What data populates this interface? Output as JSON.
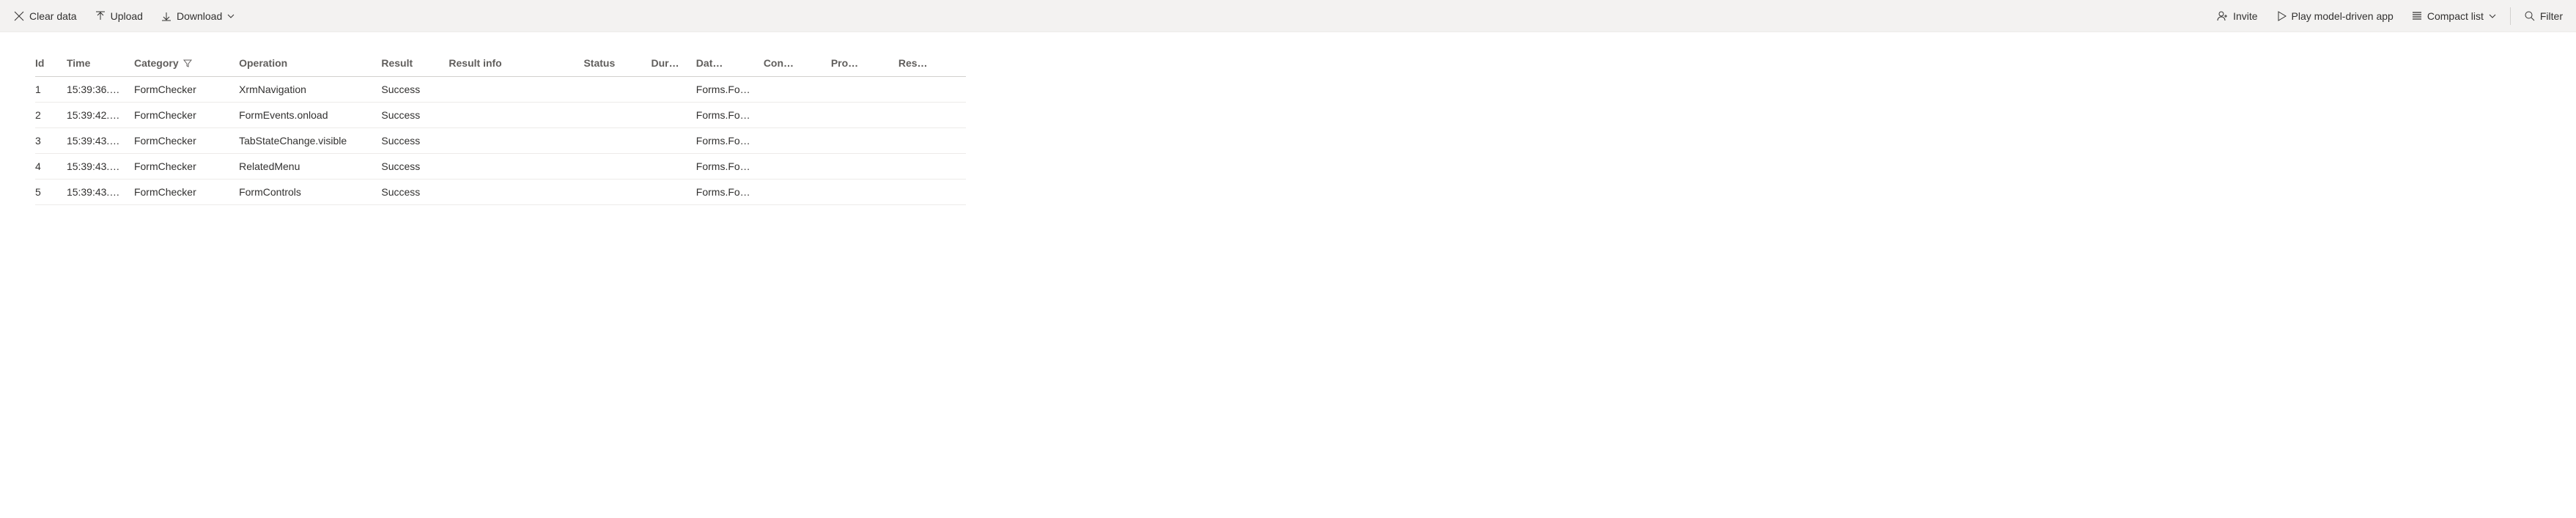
{
  "toolbar": {
    "clear_data": "Clear data",
    "upload": "Upload",
    "download": "Download",
    "invite": "Invite",
    "play": "Play model-driven app",
    "compact_list": "Compact list",
    "filter": "Filter"
  },
  "table": {
    "headers": {
      "id": "Id",
      "time": "Time",
      "category": "Category",
      "operation": "Operation",
      "result": "Result",
      "result_info": "Result info",
      "status": "Status",
      "dur": "Dur…",
      "dat": "Dat…",
      "con": "Con…",
      "pro": "Pro…",
      "res": "Res…"
    },
    "rows": [
      {
        "id": "1",
        "time": "15:39:36.…",
        "category": "FormChecker",
        "operation": "XrmNavigation",
        "result": "Success",
        "result_info": "",
        "status": "",
        "dur": "",
        "dat": "Forms.Fo…",
        "con": "",
        "pro": "",
        "res": ""
      },
      {
        "id": "2",
        "time": "15:39:42.…",
        "category": "FormChecker",
        "operation": "FormEvents.onload",
        "result": "Success",
        "result_info": "",
        "status": "",
        "dur": "",
        "dat": "Forms.Fo…",
        "con": "",
        "pro": "",
        "res": ""
      },
      {
        "id": "3",
        "time": "15:39:43.…",
        "category": "FormChecker",
        "operation": "TabStateChange.visible",
        "result": "Success",
        "result_info": "",
        "status": "",
        "dur": "",
        "dat": "Forms.Fo…",
        "con": "",
        "pro": "",
        "res": ""
      },
      {
        "id": "4",
        "time": "15:39:43.…",
        "category": "FormChecker",
        "operation": "RelatedMenu",
        "result": "Success",
        "result_info": "",
        "status": "",
        "dur": "",
        "dat": "Forms.Fo…",
        "con": "",
        "pro": "",
        "res": ""
      },
      {
        "id": "5",
        "time": "15:39:43.…",
        "category": "FormChecker",
        "operation": "FormControls",
        "result": "Success",
        "result_info": "",
        "status": "",
        "dur": "",
        "dat": "Forms.Fo…",
        "con": "",
        "pro": "",
        "res": ""
      }
    ]
  }
}
